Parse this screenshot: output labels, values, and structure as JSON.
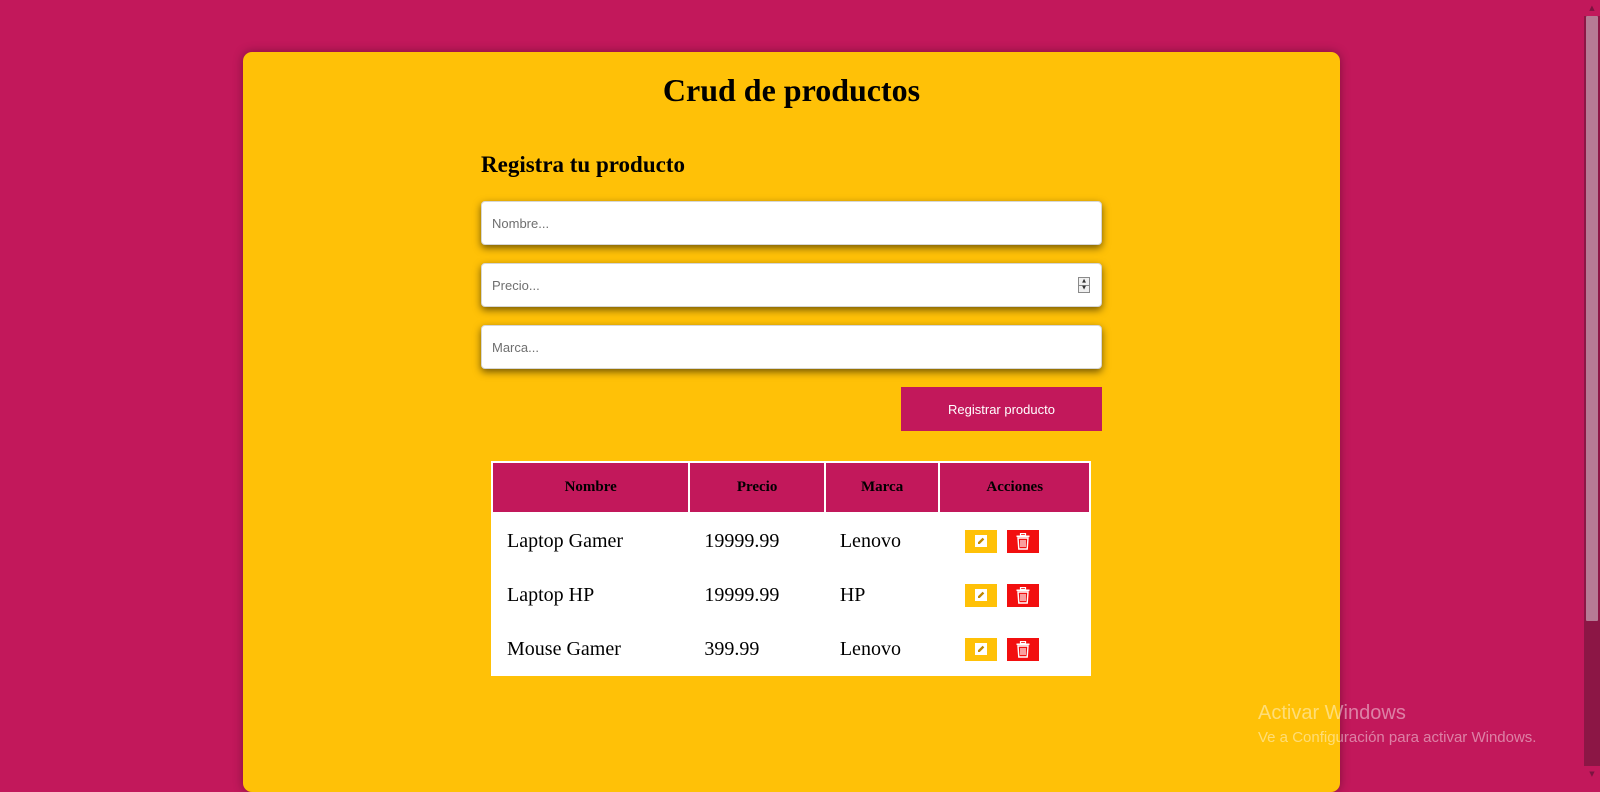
{
  "title": "Crud de productos",
  "form": {
    "heading": "Registra tu producto",
    "nombre_placeholder": "Nombre...",
    "precio_placeholder": "Precio...",
    "marca_placeholder": "Marca...",
    "submit_label": "Registrar producto"
  },
  "table": {
    "headers": [
      "Nombre",
      "Precio",
      "Marca",
      "Acciones"
    ],
    "rows": [
      {
        "nombre": "Laptop Gamer",
        "precio": "19999.99",
        "marca": "Lenovo"
      },
      {
        "nombre": "Laptop HP",
        "precio": "19999.99",
        "marca": "HP"
      },
      {
        "nombre": "Mouse Gamer",
        "precio": "399.99",
        "marca": "Lenovo"
      }
    ],
    "action_icons": [
      "pencil-icon",
      "trash-icon"
    ]
  },
  "watermark": {
    "title": "Activar Windows",
    "subtitle": "Ve a Configuración para activar Windows."
  },
  "colors": {
    "background": "#c2185b",
    "card": "#ffc107",
    "edit": "#ffc107",
    "delete": "#f20f0f"
  }
}
